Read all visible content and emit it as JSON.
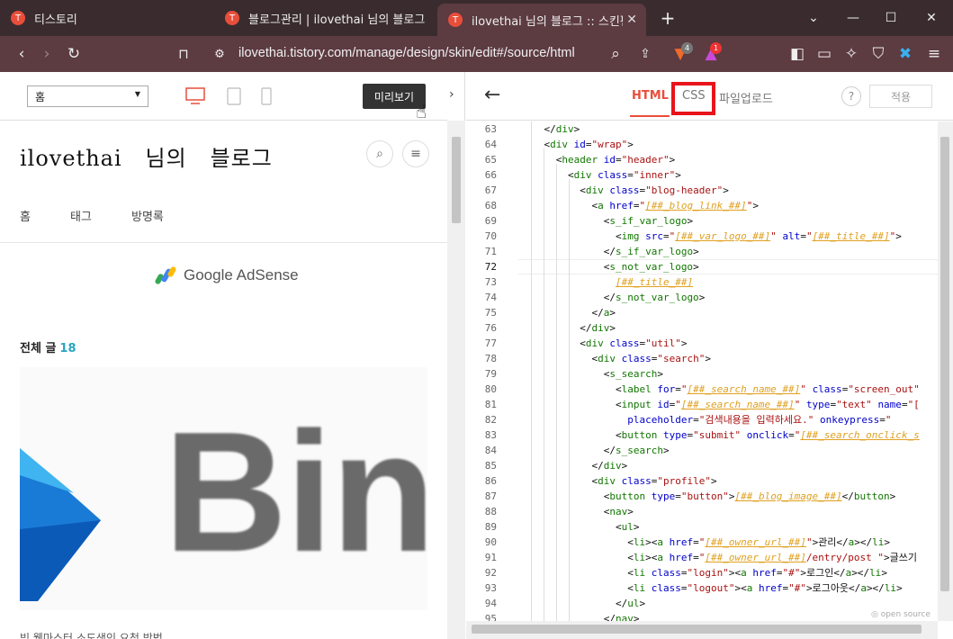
{
  "browser": {
    "tabs": [
      {
        "label": "티스토리"
      },
      {
        "label": "블로그관리 | ilovethai 님의 블로그"
      },
      {
        "label": "ilovethai 님의 블로그 :: 스킨편"
      }
    ],
    "url": "ilovethai.tistory.com/manage/design/skin/edit#/source/html",
    "brave_badge": "4",
    "rewards_badge": "1"
  },
  "preview": {
    "page_select": "홈",
    "preview_button": "미리보기",
    "blog_title": "ilovethai   님의   블로그",
    "menu": [
      "홈",
      "태그",
      "방명록"
    ],
    "adsense": "Google AdSense",
    "total_label": "전체 글",
    "total_count": "18",
    "image_text": "Bing",
    "post_title": "빙 웹마스터 소도색인 요청 방법"
  },
  "editor": {
    "tabs": {
      "html": "HTML",
      "css": "CSS",
      "file": "파일업로드"
    },
    "help": "?",
    "apply": "적용",
    "footer": "◎ open source",
    "active_line": 72
  }
}
